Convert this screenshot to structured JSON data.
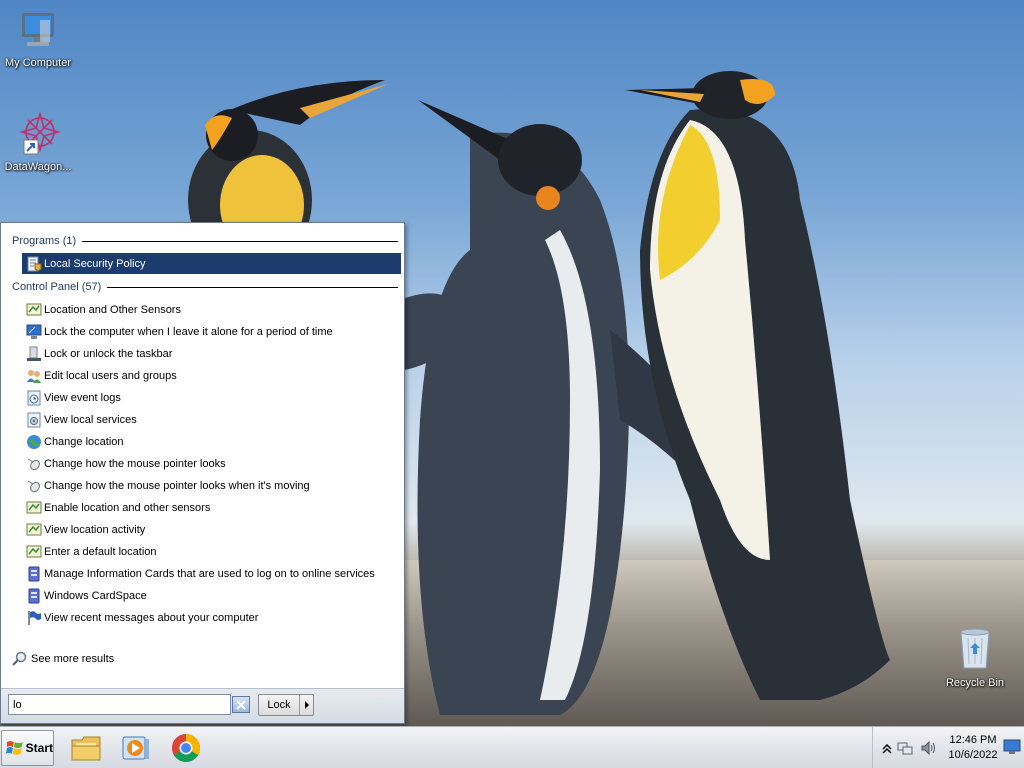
{
  "desktop": {
    "icons": [
      {
        "label": "My Computer"
      },
      {
        "label": "DataWagon..."
      },
      {
        "label": "Recycle Bin"
      }
    ]
  },
  "start_menu": {
    "programs_header": "Programs (1)",
    "programs": [
      {
        "label": "Local Security Policy",
        "icon": "security-policy-icon",
        "selected": true
      }
    ],
    "control_panel_header": "Control Panel (57)",
    "control_panel": [
      {
        "label": "Location and Other Sensors",
        "icon": "sensor-icon"
      },
      {
        "label": "Lock the computer when I leave it alone for a period of time",
        "icon": "monitor-icon"
      },
      {
        "label": "Lock or unlock the taskbar",
        "icon": "taskbar-icon"
      },
      {
        "label": "Edit local users and groups",
        "icon": "users-icon"
      },
      {
        "label": "View event logs",
        "icon": "event-log-icon"
      },
      {
        "label": "View local services",
        "icon": "services-icon"
      },
      {
        "label": "Change location",
        "icon": "globe-icon"
      },
      {
        "label": "Change how the mouse pointer looks",
        "icon": "mouse-icon"
      },
      {
        "label": "Change how the mouse pointer looks when it's moving",
        "icon": "mouse-icon"
      },
      {
        "label": "Enable location and other sensors",
        "icon": "sensor-icon"
      },
      {
        "label": "View location activity",
        "icon": "sensor-icon"
      },
      {
        "label": "Enter a default location",
        "icon": "sensor-icon"
      },
      {
        "label": "Manage Information Cards that are used to log on to online services",
        "icon": "cardspace-icon"
      },
      {
        "label": "Windows CardSpace",
        "icon": "cardspace-icon"
      },
      {
        "label": "View recent messages about your computer",
        "icon": "flag-icon"
      }
    ],
    "see_more": "See more results",
    "search": {
      "value": "lo",
      "placeholder": ""
    },
    "lock_button": "Lock"
  },
  "taskbar": {
    "start_label": "Start",
    "apps": [
      "file-explorer-icon",
      "media-player-icon",
      "chrome-icon"
    ],
    "clock": {
      "time": "12:46 PM",
      "date": "10/6/2022"
    }
  },
  "colors": {
    "selection": "#1c3c6e",
    "header_text": "#1e395b"
  }
}
